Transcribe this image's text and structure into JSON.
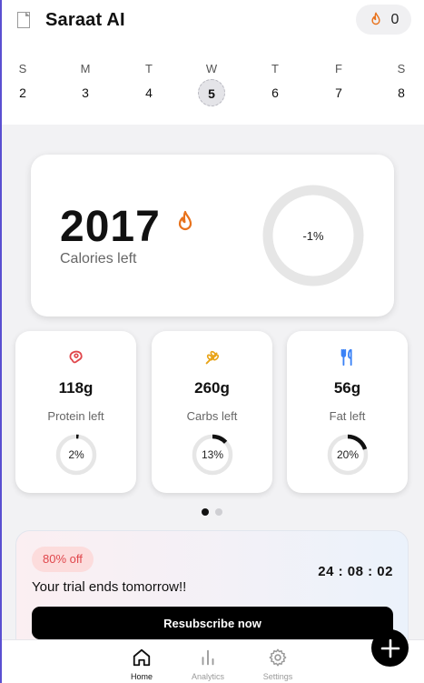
{
  "app": {
    "title": "Saraat AI",
    "streak_count": "0"
  },
  "week": [
    {
      "name": "S",
      "date": "2"
    },
    {
      "name": "M",
      "date": "3"
    },
    {
      "name": "T",
      "date": "4"
    },
    {
      "name": "W",
      "date": "5",
      "selected": true
    },
    {
      "name": "T",
      "date": "6"
    },
    {
      "name": "F",
      "date": "7"
    },
    {
      "name": "S",
      "date": "8"
    }
  ],
  "calories": {
    "value": "2017",
    "label": "Calories left",
    "ring_label": "-1%",
    "progress": 0
  },
  "macros": [
    {
      "value": "118g",
      "label": "Protein left",
      "percent_label": "2%",
      "progress": 0.02,
      "icon": "steak-icon",
      "color": "#e0474c"
    },
    {
      "value": "260g",
      "label": "Carbs left",
      "percent_label": "13%",
      "progress": 0.13,
      "icon": "wheat-icon",
      "color": "#e8a317"
    },
    {
      "value": "56g",
      "label": "Fat left",
      "percent_label": "20%",
      "progress": 0.2,
      "icon": "utensils-icon",
      "color": "#3b82f6"
    }
  ],
  "pager": {
    "pages": 2,
    "active": 0
  },
  "trial": {
    "badge": "80% off",
    "message": "Your trial ends tomorrow!!",
    "timer": "24 : 08 : 02",
    "button": "Resubscribe now"
  },
  "nav": {
    "home": "Home",
    "analytics": "Analytics",
    "settings": "Settings"
  },
  "colors": {
    "accent": "#e8721c",
    "ring_track": "#e6e6e6",
    "ring_fill": "#111111"
  }
}
